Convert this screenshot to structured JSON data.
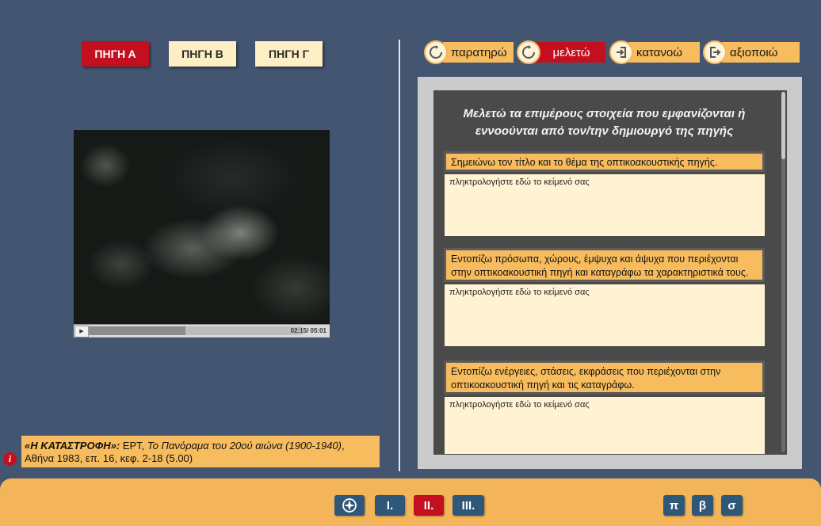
{
  "source_tabs": [
    {
      "label": "ΠΗΓΗ Α",
      "active": true
    },
    {
      "label": "ΠΗΓΗ Β",
      "active": false
    },
    {
      "label": "ΠΗΓΗ Γ",
      "active": false
    }
  ],
  "video": {
    "time": "02:15/ 05:01",
    "progress_fraction": 0.45,
    "play_icon": "play-icon"
  },
  "caption": {
    "title": "«Η ΚΑΤΑΣΤΡΟΦΗ»:",
    "source": " ΕΡΤ, ",
    "work": "Το Πανόραμα του 20ού αιώνα (1900-1940)",
    "rest": ", Αθήνα 1983, επ. 16, κεφ. 2-18 (5.00)",
    "info_glyph": "i"
  },
  "steps": [
    {
      "label": "παρατηρώ",
      "icon": "refresh-icon",
      "active": false
    },
    {
      "label": "μελετώ",
      "icon": "refresh-icon",
      "active": true
    },
    {
      "label": "κατανοώ",
      "icon": "enter-icon",
      "active": false
    },
    {
      "label": "αξιοποιώ",
      "icon": "exit-icon",
      "active": false
    }
  ],
  "panel": {
    "title_line1": "Μελετώ τα επιμέρους στοιχεία που εμφανίζονται ή",
    "title_line2": "εννοούνται από τον/την δημιουργό της πηγής",
    "questions": [
      {
        "label": "Σημειώνω τον τίτλο και το θέμα της οπτικοακουστικής πηγής.",
        "placeholder": "πληκτρολογήστε εδώ το κείμενό σας"
      },
      {
        "label": "Εντοπίζω πρόσωπα, χώρους, έμψυχα και άψυχα που περιέχονται στην οπτικοακουστική πηγή και καταγράφω τα χαρακτηριστικά τους.",
        "placeholder": "πληκτρολογήστε εδώ το κείμενό σας"
      },
      {
        "label": "Εντοπίζω ενέργειες, στάσεις, εκφράσεις που περιέχονται στην οπτικοακουστική πηγή και τις καταγράφω.",
        "placeholder": "πληκτρολογήστε εδώ το κείμενό σας"
      }
    ]
  },
  "bottom_nav": {
    "compass_icon": "compass-icon",
    "parts": [
      {
        "label": "I.",
        "active": false
      },
      {
        "label": "II.",
        "active": true
      },
      {
        "label": "III.",
        "active": false
      }
    ],
    "tools": [
      {
        "label": "π"
      },
      {
        "label": "β"
      },
      {
        "label": "σ"
      }
    ]
  },
  "colors": {
    "background": "#435571",
    "accent_red": "#c4101e",
    "accent_orange": "#f7bc5e",
    "cream": "#fff3d3",
    "nav_blue": "#2f5777"
  }
}
